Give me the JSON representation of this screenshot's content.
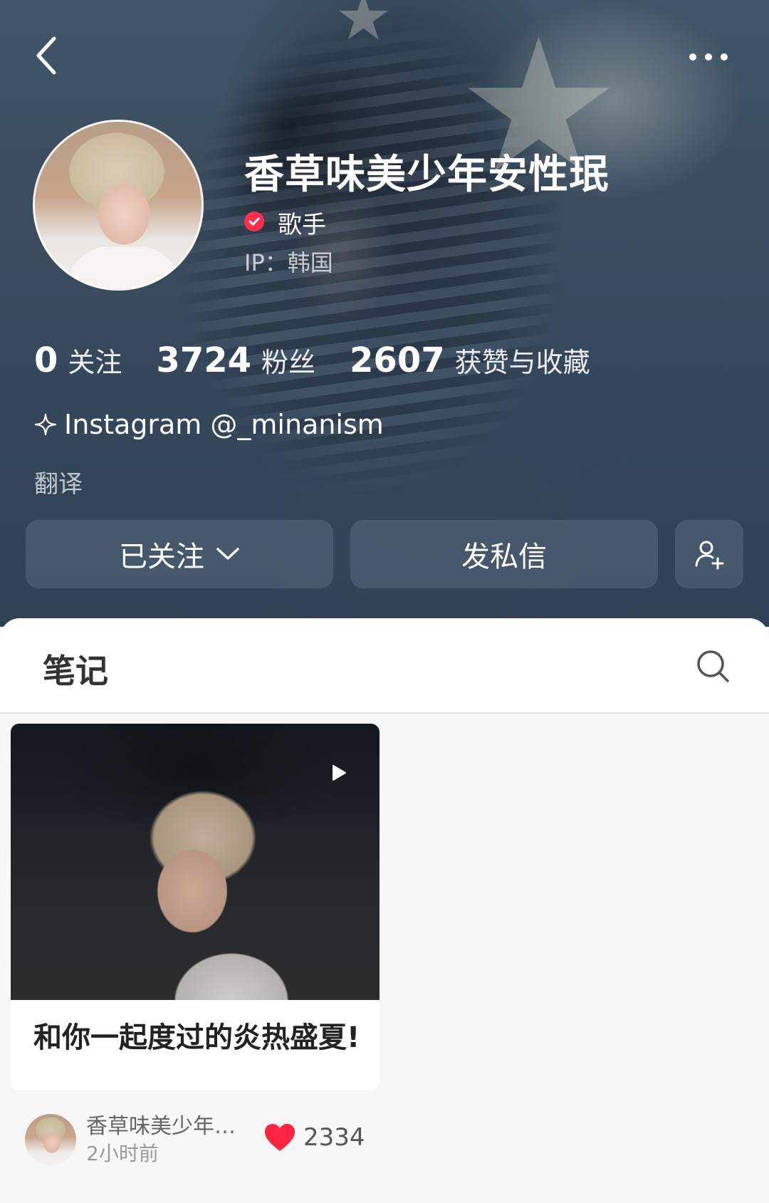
{
  "nav": {
    "back_icon": "chevron-left-icon",
    "more_icon": "more-dots-icon"
  },
  "profile": {
    "name": "香草味美少年安性珉",
    "verified_icon": "verified-check-icon",
    "role": "歌手",
    "ip": "IP：韩国",
    "stats": [
      {
        "value": "0",
        "label": "关注"
      },
      {
        "value": "3724",
        "label": "粉丝"
      },
      {
        "value": "2607",
        "label": "获赞与收藏"
      }
    ],
    "bio": "Instagram @_minanism",
    "translate_label": "翻译"
  },
  "actions": {
    "follow_label": "已关注",
    "message_label": "发私信",
    "add_friend_icon": "add-user-icon"
  },
  "tabs": {
    "notes_label": "笔记",
    "search_icon": "search-icon"
  },
  "notes": [
    {
      "title": "和你一起度过的炎热盛夏!",
      "author": "香草味美少年…",
      "time": "2小时前",
      "likes": "2334",
      "is_video": true
    }
  ],
  "colors": {
    "accent_red": "#ff2442",
    "header_bg": "#3a4c5e",
    "button_bg": "#5a697d"
  }
}
